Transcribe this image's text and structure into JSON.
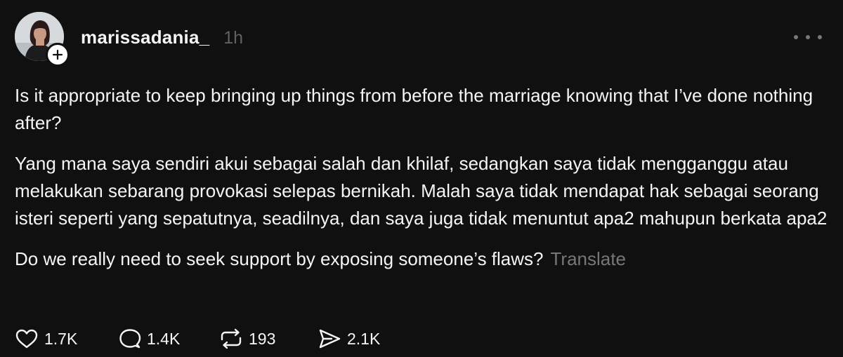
{
  "post": {
    "username": "marissadania_",
    "time": "1h",
    "paragraphs": [
      "Is it appropriate to keep bringing up things from before the marriage knowing that I’ve done nothing after?",
      "Yang mana saya sendiri akui sebagai salah dan khilaf, sedangkan saya tidak mengganggu atau melakukan sebarang provokasi selepas bernikah. Malah saya tidak mendapat hak sebagai seorang isteri seperti yang sepatutnya, seadilnya, dan saya juga tidak menuntut apa2 mahupun berkata apa2",
      "Do we really need to seek support by exposing someone’s flaws?"
    ],
    "translate_label": "Translate"
  },
  "actions": {
    "likes": "1.7K",
    "comments": "1.4K",
    "reposts": "193",
    "shares": "2.1K"
  },
  "icons": {
    "avatar": "avatar-photo",
    "follow": "plus-icon",
    "more": "more-horizontal-icon",
    "like": "heart-icon",
    "comment": "comment-bubble-icon",
    "repost": "repost-icon",
    "share": "send-icon"
  },
  "colors": {
    "background": "#101010",
    "text": "#f3f5f7",
    "muted": "#777777"
  }
}
